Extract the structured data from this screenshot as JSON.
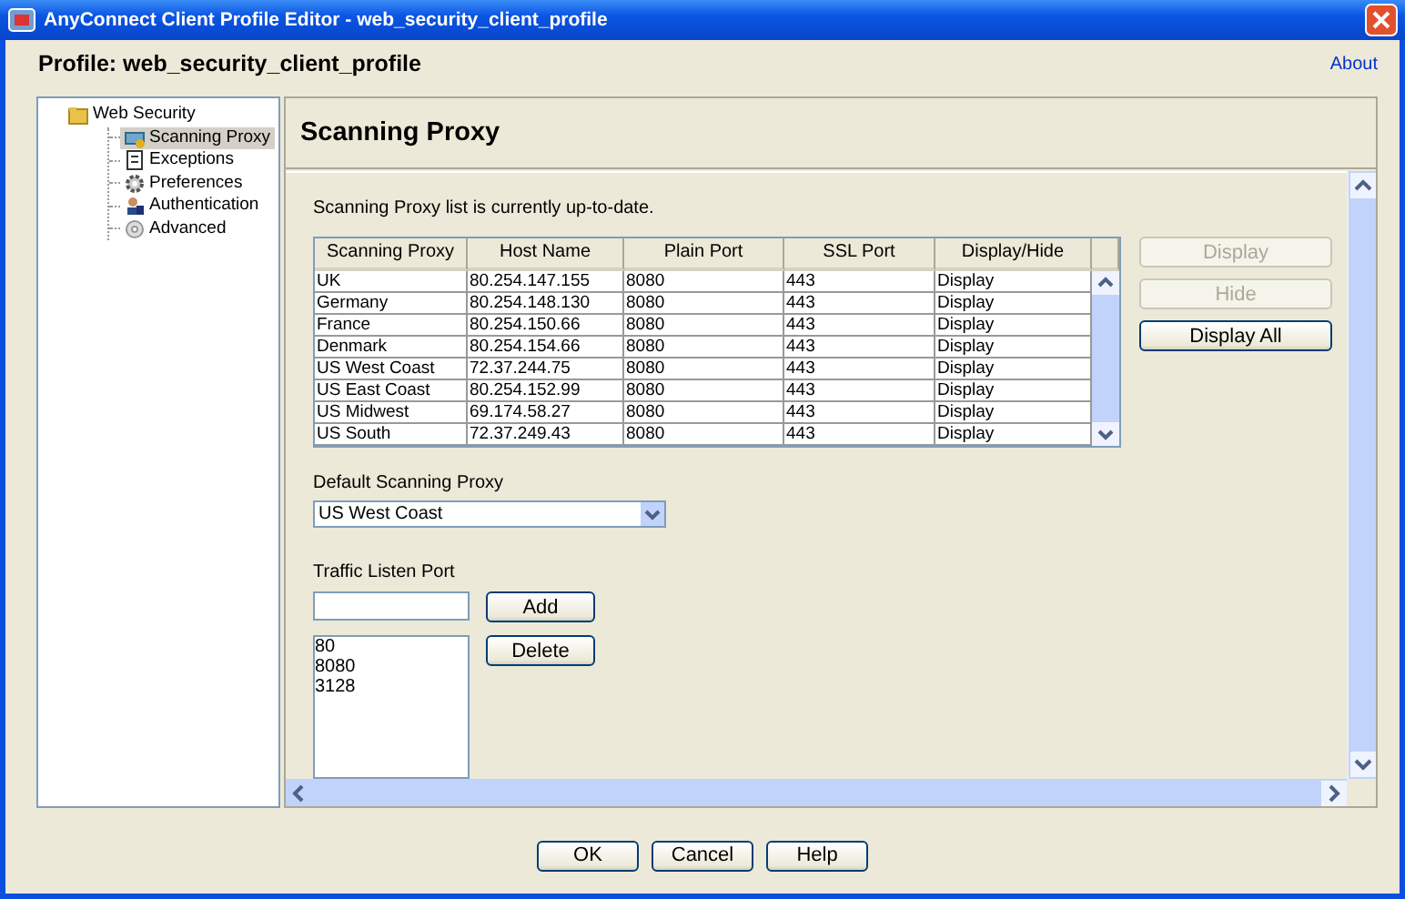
{
  "window": {
    "title": "AnyConnect Client Profile Editor - web_security_client_profile"
  },
  "profile": {
    "label": "Profile:  web_security_client_profile",
    "about": "About"
  },
  "tree": [
    {
      "label": "Web Security",
      "kind": "folder",
      "selected": false,
      "children": [
        {
          "label": "Scanning Proxy",
          "kind": "proxy",
          "selected": true
        },
        {
          "label": "Exceptions",
          "kind": "document",
          "selected": false
        },
        {
          "label": "Preferences",
          "kind": "gear",
          "selected": false
        },
        {
          "label": "Authentication",
          "kind": "user",
          "selected": false
        },
        {
          "label": "Advanced",
          "kind": "disc",
          "selected": false
        }
      ]
    }
  ],
  "panel": {
    "title": "Scanning Proxy",
    "status": "Scanning Proxy list is currently up-to-date."
  },
  "table": {
    "columns": [
      "Scanning Proxy",
      "Host Name",
      "Plain Port",
      "SSL Port",
      "Display/Hide"
    ],
    "rows": [
      [
        "UK",
        "80.254.147.155",
        "8080",
        "443",
        "Display"
      ],
      [
        "Germany",
        "80.254.148.130",
        "8080",
        "443",
        "Display"
      ],
      [
        "France",
        "80.254.150.66",
        "8080",
        "443",
        "Display"
      ],
      [
        "Denmark",
        "80.254.154.66",
        "8080",
        "443",
        "Display"
      ],
      [
        "US West Coast",
        "72.37.244.75",
        "8080",
        "443",
        "Display"
      ],
      [
        "US East Coast",
        "80.254.152.99",
        "8080",
        "443",
        "Display"
      ],
      [
        "US Midwest",
        "69.174.58.27",
        "8080",
        "443",
        "Display"
      ],
      [
        "US South",
        "72.37.249.43",
        "8080",
        "443",
        "Display"
      ]
    ]
  },
  "side_buttons": [
    {
      "label": "Display",
      "disabled": true
    },
    {
      "label": "Hide",
      "disabled": true
    },
    {
      "label": "Display All",
      "disabled": false
    }
  ],
  "default_proxy": {
    "label": "Default Scanning Proxy",
    "value": "US West Coast"
  },
  "listen_port": {
    "label": "Traffic Listen Port",
    "add": "Add",
    "delete": "Delete",
    "ports": [
      "80",
      "8080",
      "3128"
    ]
  },
  "buttons": [
    "OK",
    "Cancel",
    "Help"
  ]
}
